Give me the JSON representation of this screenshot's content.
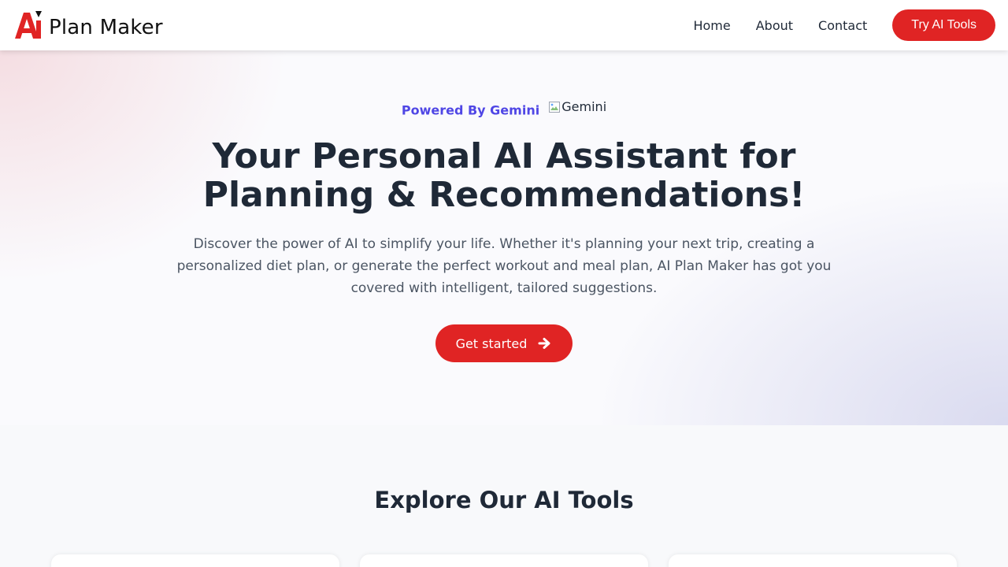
{
  "header": {
    "logo_text": "Plan Maker",
    "nav": [
      {
        "label": "Home"
      },
      {
        "label": "About"
      },
      {
        "label": "Contact"
      }
    ],
    "cta_label": "Try AI Tools"
  },
  "hero": {
    "powered_label": "Powered By Gemini",
    "powered_image_alt": "Gemini",
    "title_line1": "Your Personal AI Assistant for",
    "title_line2": "Planning & Recommendations!",
    "description": "Discover the power of AI to simplify your life. Whether it's planning your next trip, creating a personalized diet plan, or generate the perfect workout and meal plan, AI Plan Maker has got you covered with intelligent, tailored suggestions.",
    "cta_label": "Get started",
    "cta_icon": "arrow-right-icon"
  },
  "tools": {
    "title": "Explore Our AI Tools"
  },
  "colors": {
    "brand_red": "#e02424",
    "accent_indigo": "#4f46e5",
    "heading": "#1f2937",
    "body_text": "#4b5563"
  }
}
